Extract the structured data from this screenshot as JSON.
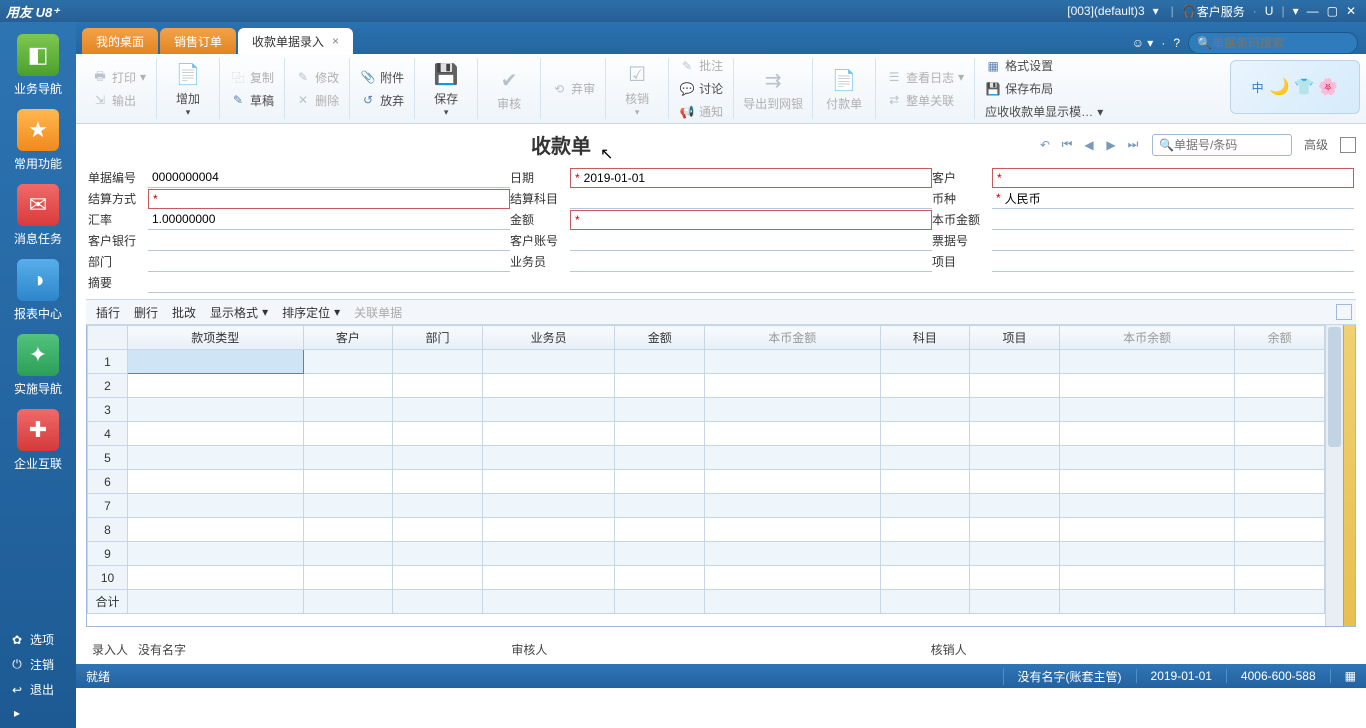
{
  "titlebar": {
    "logo": "用友 U8⁺",
    "account": "[003](default)3",
    "service": "客户服务",
    "u": "U"
  },
  "sidebar": {
    "items": [
      {
        "label": "业务导航",
        "icon": "◧"
      },
      {
        "label": "常用功能",
        "icon": "★"
      },
      {
        "label": "消息任务",
        "icon": "✉"
      },
      {
        "label": "报表中心",
        "icon": "◑"
      },
      {
        "label": "实施导航",
        "icon": "✦"
      },
      {
        "label": "企业互联",
        "icon": "✚"
      }
    ],
    "bottom": [
      {
        "label": "选项",
        "icon": "✿"
      },
      {
        "label": "注销",
        "icon": "⏻"
      },
      {
        "label": "退出",
        "icon": "↩"
      }
    ]
  },
  "tabs": [
    {
      "label": "我的桌面",
      "active": false
    },
    {
      "label": "销售订单",
      "active": false
    },
    {
      "label": "收款单据录入",
      "active": true
    }
  ],
  "topsearch": {
    "placeholder": "单据条码搜索"
  },
  "ribbon": {
    "g1": [
      {
        "l": "打印",
        "d": true
      },
      {
        "l": "输出",
        "d": true
      }
    ],
    "big1": {
      "l": "增加"
    },
    "g2": [
      {
        "l": "复制",
        "d": true
      },
      {
        "l": "草稿"
      }
    ],
    "g3": [
      {
        "l": "修改",
        "d": true
      },
      {
        "l": "删除",
        "d": true
      }
    ],
    "g4": [
      {
        "l": "附件",
        "icon": "📎"
      },
      {
        "l": "放弃",
        "icon": "↺"
      }
    ],
    "big2": {
      "l": "保存",
      "icon": "💾"
    },
    "big3": {
      "l": "审核",
      "d": true
    },
    "g5": [
      {
        "l": "弃审",
        "d": true
      }
    ],
    "big4": {
      "l": "核销",
      "d": true
    },
    "g6": [
      {
        "l": "批注",
        "d": true
      },
      {
        "l": "讨论"
      },
      {
        "l": "通知",
        "d": true
      }
    ],
    "big5": {
      "l": "导出到网银",
      "d": true
    },
    "big6": {
      "l": "付款单",
      "d": true
    },
    "g7": [
      {
        "l": "查看日志",
        "d": true
      },
      {
        "l": "整单关联",
        "d": true
      }
    ],
    "g8": [
      {
        "l": "格式设置"
      },
      {
        "l": "保存布局"
      },
      {
        "l": "应收收款单显示模…"
      }
    ],
    "decor": "中"
  },
  "doc": {
    "title": "收款单",
    "find_placeholder": "单据号/条码",
    "advanced": "高级"
  },
  "form": {
    "r1": [
      {
        "label": "单据编号",
        "value": "0000000004"
      },
      {
        "label": "日期",
        "req": true,
        "value": "2019-01-01"
      },
      {
        "label": "客户",
        "req": true,
        "value": ""
      }
    ],
    "r2": [
      {
        "label": "结算方式",
        "req": true,
        "value": ""
      },
      {
        "label": "结算科目",
        "value": ""
      },
      {
        "label": "币种",
        "req": true,
        "value": "人民币",
        "plain": true
      }
    ],
    "r3": [
      {
        "label": "汇率",
        "value": "1.00000000"
      },
      {
        "label": "金额",
        "req": true,
        "value": ""
      },
      {
        "label": "本币金额",
        "value": ""
      }
    ],
    "r4": [
      {
        "label": "客户银行",
        "value": ""
      },
      {
        "label": "客户账号",
        "value": ""
      },
      {
        "label": "票据号",
        "value": ""
      }
    ],
    "r5": [
      {
        "label": "部门",
        "value": ""
      },
      {
        "label": "业务员",
        "value": ""
      },
      {
        "label": "项目",
        "value": ""
      }
    ],
    "r6": [
      {
        "label": "摘要",
        "value": "",
        "full": true
      }
    ]
  },
  "linebar": {
    "items": [
      "插行",
      "删行",
      "批改"
    ],
    "fmt": "显示格式",
    "sort": "排序定位",
    "rel": "关联单据"
  },
  "grid": {
    "cols": [
      {
        "l": "款项类型"
      },
      {
        "l": "客户"
      },
      {
        "l": "部门"
      },
      {
        "l": "业务员"
      },
      {
        "l": "金额"
      },
      {
        "l": "本币金额",
        "dim": true
      },
      {
        "l": "科目"
      },
      {
        "l": "项目"
      },
      {
        "l": "本币余额",
        "dim": true
      },
      {
        "l": "余额",
        "dim": true
      }
    ],
    "rows": 10,
    "sum": "合计"
  },
  "sign": {
    "entry_l": "录入人",
    "entry_v": "没有名字",
    "audit_l": "审核人",
    "verify_l": "核销人"
  },
  "status": {
    "ready": "就绪",
    "user": "没有名字(账套主管)",
    "date": "2019-01-01",
    "phone": "4006-600-588"
  }
}
